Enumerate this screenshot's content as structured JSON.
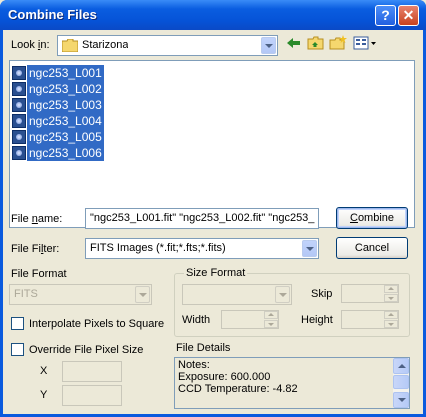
{
  "window": {
    "title": "Combine Files",
    "help_glyph": "?",
    "close_glyph": "✕"
  },
  "lookin": {
    "label_pre": "Look ",
    "label_u": "i",
    "label_post": "n:",
    "folder": "Starizona",
    "toolbar_icons": [
      "back-arrow-icon",
      "up-folder-icon",
      "new-folder-icon",
      "view-menu-icon"
    ]
  },
  "files": [
    "ngc253_L001",
    "ngc253_L002",
    "ngc253_L003",
    "ngc253_L004",
    "ngc253_L005",
    "ngc253_L006"
  ],
  "filename": {
    "label_pre": "File ",
    "label_u": "n",
    "label_post": "ame:",
    "value": "\"ngc253_L001.fit\" \"ngc253_L002.fit\" \"ngc253_"
  },
  "filefilter": {
    "label_pre": "File Fi",
    "label_u": "l",
    "label_post": "ter:",
    "value": "FITS Images (*.fit;*.fts;*.fits)"
  },
  "buttons": {
    "combine_u": "C",
    "combine_rest": "ombine",
    "cancel": "Cancel"
  },
  "fileformat": {
    "label": "File Format",
    "value": "FITS"
  },
  "interpolate": {
    "label": "Interpolate Pixels to Square",
    "checked": false
  },
  "override": {
    "label": "Override File Pixel Size",
    "checked": false,
    "x_label": "X",
    "y_label": "Y"
  },
  "sizeformat": {
    "label": "Size Format",
    "skip_label": "Skip",
    "width_label": "Width",
    "height_label": "Height"
  },
  "details": {
    "label": "File Details",
    "lines": [
      "Notes:",
      "Exposure: 600.000",
      "CCD Temperature: -4.82"
    ]
  }
}
